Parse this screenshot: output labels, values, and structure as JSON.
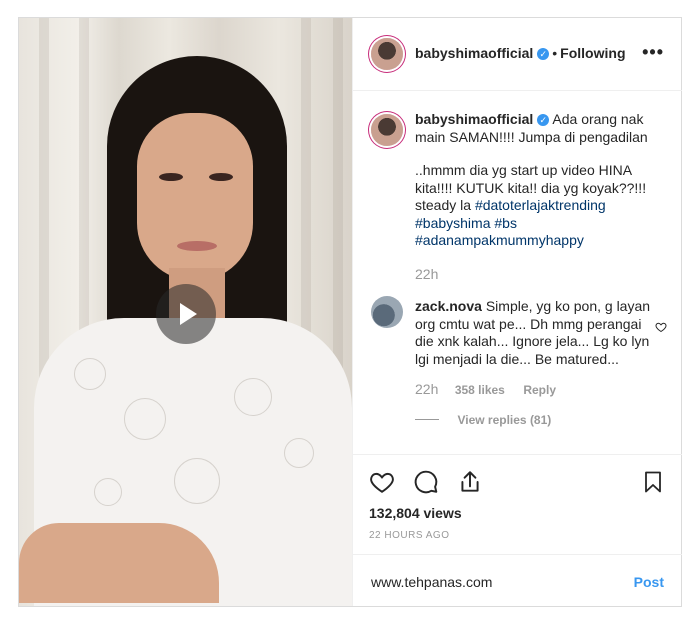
{
  "post": {
    "username": "babyshimaofficial",
    "verified_mark": "✓",
    "separator": "•",
    "follow_status": "Following",
    "more_label": "•••",
    "video": {
      "play_icon": "play-icon"
    }
  },
  "caption": {
    "username": "babyshimaofficial",
    "line1": "Ada orang nak main SAMAN!!!! Jumpa di pengadilan",
    "line2": "..hmmm dia yg start up video HINA kita!!!! KUTUK kita!! dia yg koyak??!!! steady la",
    "hashtags": [
      "#datoterlajaktrending",
      "#babyshima",
      "#bs",
      "#adanampakmummyhappy"
    ],
    "time": "22h"
  },
  "comments": [
    {
      "username": "zack.nova",
      "text": "Simple, yg ko pon, g layan org cmtu wat pe... Dh mmg perangai die xnk kalah... Ignore jela... Lg ko lyn lgi menjadi la die... Be matured...",
      "time": "22h",
      "likes": "358 likes",
      "reply": "Reply",
      "view_replies": "View replies (81)"
    }
  ],
  "stats": {
    "views": "132,804 views",
    "time_ago": "22 HOURS AGO"
  },
  "footer": {
    "site": "www.tehpanas.com",
    "post_label": "Post"
  },
  "colors": {
    "link": "#003569",
    "accent": "#3897f0",
    "muted": "#999999",
    "story_ring": "#c72c7a"
  },
  "icons": [
    "play-icon",
    "verified-icon",
    "more-icon",
    "heart-icon",
    "comment-icon",
    "share-icon",
    "bookmark-icon",
    "comment-heart-icon"
  ]
}
